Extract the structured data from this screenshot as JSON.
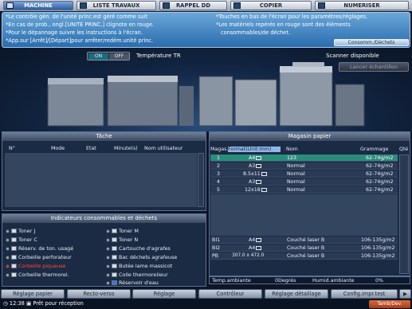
{
  "tabs": [
    {
      "label": "MACHINE",
      "active": true
    },
    {
      "label": "LISTE TRAVAUX",
      "active": false
    },
    {
      "label": "RAPPEL DD",
      "active": false
    },
    {
      "label": "COPIER",
      "active": false
    },
    {
      "label": "NUMERISER",
      "active": false
    }
  ],
  "messages": {
    "left": [
      "*Le contrôle gén. de l'unité princ.est géré comme suit",
      "*En cas de prob., ongl.[UNITE PRINC.] clignote en rouge.",
      "*Pour le dépannage suivre les instructions à l'écran.",
      "*App.sur [Arrêt]/[Départ]pour arrêter/redém.unité princ."
    ],
    "right": [
      "*Touches en bas de l'écran pour les paramètres/réglages.",
      "*Les matériels repérés en rouge sont des éléments",
      "consommables/de déchet."
    ],
    "button": "Consomm./Déchets"
  },
  "machine": {
    "on_label": "ON",
    "off_label": "OFF",
    "temp_label": "Température TR",
    "scanner_status": "Scanner disponible",
    "launch_sample": "Lancer échantillon"
  },
  "tache": {
    "title": "Tâche",
    "headers": [
      "N°",
      "Mode",
      "Etat",
      "Minute(s)",
      "Nom utilisateur"
    ]
  },
  "consumables": {
    "title": "Indicateurs consommables et déchets",
    "left": [
      {
        "label": "Toner J",
        "status": "normal"
      },
      {
        "label": "Toner C",
        "status": "normal"
      },
      {
        "label": "Réserv. de ton. usagé",
        "status": "normal"
      },
      {
        "label": "Corbeille perforateur",
        "status": "normal"
      },
      {
        "label": "Corbeille piqueuse",
        "status": "alert"
      },
      {
        "label": "Corbeille thermorel.",
        "status": "normal"
      }
    ],
    "right": [
      {
        "label": "Toner M",
        "status": "normal"
      },
      {
        "label": "Toner N",
        "status": "normal"
      },
      {
        "label": "Cartouche d'agrafes",
        "status": "normal"
      },
      {
        "label": "Bac déchets agrafeuse",
        "status": "normal"
      },
      {
        "label": "Butée lame massicot",
        "status": "normal"
      },
      {
        "label": "Colle thermorelieur",
        "status": "normal"
      },
      {
        "label": "Réservoir d'eau",
        "status": "normal"
      }
    ]
  },
  "magasin": {
    "title": "Magasin papier",
    "headers": [
      "Magas.",
      "Format(Unit:mm)",
      "Nom",
      "Grammage",
      "Qté"
    ],
    "rows": [
      {
        "magas": "1",
        "format": "A4",
        "nom": "123",
        "grammage": "62-74g/m2",
        "selected": true
      },
      {
        "magas": "2",
        "format": "A3",
        "nom": "Normal",
        "grammage": "62-74g/m2",
        "selected": false
      },
      {
        "magas": "3",
        "format": "8.5x11",
        "nom": "Normal",
        "grammage": "62-74g/m2",
        "selected": false
      },
      {
        "magas": "4",
        "format": "A3",
        "nom": "Normal",
        "grammage": "62-74g/m2",
        "selected": false
      },
      {
        "magas": "5",
        "format": "12x18",
        "nom": "Normal",
        "grammage": "62-74g/m2",
        "selected": false
      }
    ],
    "bottom_rows": [
      {
        "magas": "BI1",
        "format": "A4",
        "nom": "Couché laser B",
        "grammage": "106-135g/m2"
      },
      {
        "magas": "BI2",
        "format": "A4",
        "nom": "Couché laser B",
        "grammage": "106-135g/m2"
      },
      {
        "magas": "PB",
        "format": "307.0 x 472.0",
        "nom": "Couché laser B",
        "grammage": "106-135g/m2"
      }
    ],
    "temp_ambiante_label": "Temp.ambiante",
    "temp_ambiante_value": "0Degrés",
    "humid_label": "Humid.ambiante",
    "humid_value": "0%"
  },
  "bottom_tabs": [
    "Réglage papier",
    "Recto-verso",
    "Réglage",
    "Contrôleur",
    "Réglage détaillage",
    "Config.impr.test"
  ],
  "status": {
    "time": "12:38",
    "text": "Prêt pour réception",
    "tamb": "Tamb/Dev."
  }
}
